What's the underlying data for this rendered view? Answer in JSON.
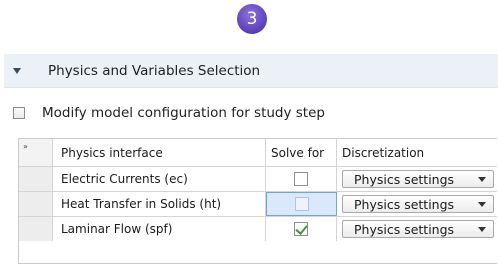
{
  "step_badge": "3",
  "section": {
    "title": "Physics and Variables Selection"
  },
  "modify_config": {
    "label": "Modify model configuration for study step",
    "checked": false
  },
  "table": {
    "expand_glyph": "»",
    "headers": [
      "Physics interface",
      "Solve for",
      "Discretization"
    ],
    "rows": [
      {
        "name": "Electric Currents (ec)",
        "solve": false,
        "discretization": "Physics settings"
      },
      {
        "name": "Heat Transfer in Solids (ht)",
        "solve": false,
        "discretization": "Physics settings"
      },
      {
        "name": "Laminar Flow (spf)",
        "solve": true,
        "discretization": "Physics settings"
      }
    ]
  }
}
